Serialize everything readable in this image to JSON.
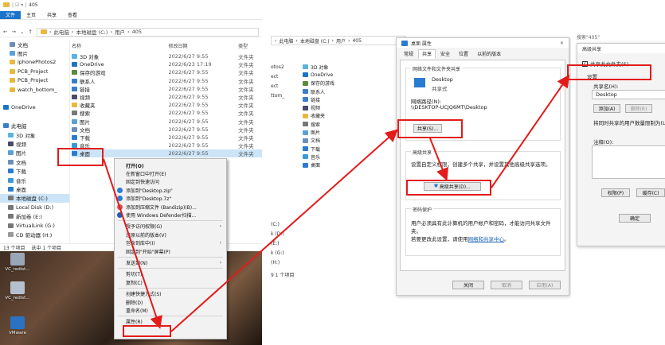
{
  "explorer": {
    "title": "405",
    "ribbon_tabs": [
      "文件",
      "主页",
      "共享",
      "查看"
    ],
    "breadcrumb": [
      "此电脑",
      "本地磁盘 (C:)",
      "用户",
      "405"
    ],
    "sidebar": [
      {
        "label": "文档",
        "icon": "document-icon"
      },
      {
        "label": "图片",
        "icon": "picture-icon"
      },
      {
        "label": "iphonePhotos2",
        "icon": "folder-icon"
      },
      {
        "label": "PCB_Project",
        "icon": "folder-icon"
      },
      {
        "label": "PCB_Project",
        "icon": "folder-icon"
      },
      {
        "label": "watch_bottom_",
        "icon": "folder-icon"
      },
      {
        "label": "",
        "icon": ""
      },
      {
        "label": "OneDrive",
        "icon": "cloud-icon"
      },
      {
        "label": "",
        "icon": ""
      },
      {
        "label": "此电脑",
        "icon": "computer-icon"
      },
      {
        "label": "3D 对象",
        "icon": "cube-icon"
      },
      {
        "label": "视频",
        "icon": "video-icon"
      },
      {
        "label": "图片",
        "icon": "picture-icon"
      },
      {
        "label": "文档",
        "icon": "document-icon"
      },
      {
        "label": "下载",
        "icon": "download-icon"
      },
      {
        "label": "音乐",
        "icon": "music-icon"
      },
      {
        "label": "桌面",
        "icon": "desktop-icon"
      },
      {
        "label": "本地磁盘 (C:)",
        "icon": "drive-icon"
      },
      {
        "label": "Local Disk (D:)",
        "icon": "drive-icon"
      },
      {
        "label": "新加卷 (E:)",
        "icon": "drive-icon"
      },
      {
        "label": "VirtualLink (G:)",
        "icon": "drive-icon"
      },
      {
        "label": "CD 驱动器 (H:)",
        "icon": "cd-icon"
      }
    ],
    "columns": [
      "名称",
      "修改日期",
      "类型"
    ],
    "files": [
      {
        "name": "3D 对象",
        "date": "2022/6/27 9:55",
        "type": "文件夹"
      },
      {
        "name": "OneDrive",
        "date": "2022/6/23 17:19",
        "type": "文件夹"
      },
      {
        "name": "保存的游戏",
        "date": "2022/6/27 9:55",
        "type": "文件夹"
      },
      {
        "name": "联系人",
        "date": "2022/6/27 9:55",
        "type": "文件夹"
      },
      {
        "name": "链接",
        "date": "2022/6/27 9:55",
        "type": "文件夹"
      },
      {
        "name": "视频",
        "date": "2022/6/27 9:55",
        "type": "文件夹"
      },
      {
        "name": "收藏夹",
        "date": "2022/6/27 9:55",
        "type": "文件夹"
      },
      {
        "name": "搜索",
        "date": "2022/6/27 9:55",
        "type": "文件夹"
      },
      {
        "name": "图片",
        "date": "2022/6/27 9:55",
        "type": "文件夹"
      },
      {
        "name": "文档",
        "date": "2022/6/27 9:55",
        "type": "文件夹"
      },
      {
        "name": "下载",
        "date": "2022/6/27 9:55",
        "type": "文件夹"
      },
      {
        "name": "音乐",
        "date": "2022/6/27 9:55",
        "type": "文件夹"
      },
      {
        "name": "桌面",
        "date": "2022/6/27 9:55",
        "type": "文件夹"
      }
    ],
    "status": [
      "13 个项目",
      "选中 1 个项目"
    ],
    "desktop_icons": [
      "VC_redist...",
      "VC_redist...",
      "VMware"
    ]
  },
  "context_menu": [
    {
      "label": "打开(O)",
      "bold": true
    },
    {
      "label": "在新窗口中打开(E)"
    },
    {
      "label": "固定到快速访问"
    },
    {
      "label": "添加到\"Desktop.zip\"",
      "icon": true
    },
    {
      "label": "添加到\"Desktop.7z\"",
      "icon": true
    },
    {
      "label": "添加到压缩文件 (Bandizip)(B)...",
      "icon": true
    },
    {
      "label": "使用 Windows Defender扫描...",
      "icon": true
    },
    {
      "sep": true
    },
    {
      "label": "授予访问权限(G)",
      "arrow": true
    },
    {
      "label": "还原以前的版本(V)"
    },
    {
      "label": "包含到库中(I)",
      "arrow": true
    },
    {
      "label": "固定到\"开始\"屏幕(P)"
    },
    {
      "sep": true
    },
    {
      "label": "发送到(N)",
      "arrow": true
    },
    {
      "sep": true
    },
    {
      "label": "剪切(T)"
    },
    {
      "label": "复制(C)"
    },
    {
      "sep": true
    },
    {
      "label": "创建快捷方式(S)"
    },
    {
      "label": "删除(D)"
    },
    {
      "label": "重命名(M)"
    },
    {
      "sep": true
    },
    {
      "label": "属性(R)"
    }
  ],
  "middle": {
    "breadcrumb": [
      "此电脑",
      "本地磁盘 (C:)",
      "用户",
      "405"
    ],
    "sidebar_frag": [
      "otos2",
      "ect",
      "ect",
      "ttom_"
    ],
    "files": [
      "3D 对象",
      "OneDrive",
      "保存的游戏",
      "联系人",
      "链接",
      "视频",
      "收藏夹",
      "搜索",
      "图片",
      "文档",
      "下载",
      "音乐",
      "桌面"
    ],
    "drive_frag": [
      "(C:)",
      "k (D:)",
      "(E:)",
      "k (G:)",
      "(H:)"
    ],
    "status_frag": "9 1 个项目",
    "dialog": {
      "title": "桌面 属性",
      "tabs": [
        "常规",
        "共享",
        "安全",
        "位置",
        "以前的版本"
      ],
      "g1_title": "网络文件和文件夹共享",
      "item_name": "Desktop",
      "item_state": "共享式",
      "net_path_label": "网络路径(N):",
      "net_path": "\\\\DESKTOP-UCJQ6MT\\Desktop",
      "share_btn": "共享(S)...",
      "g2_title": "高级共享",
      "g2_desc": "设置自定义权限，创建多个共享，并设置其他高级共享选项。",
      "adv_btn": "高级共享(D)...",
      "g3_title": "密码保护",
      "g3_desc1": "用户必须具有此计算机的用户帐户和密码，才能访问共享文件夹。",
      "g3_desc2_prefix": "若要更改此设置，请使用",
      "g3_link": "网络和共享中心",
      "g3_desc2_suffix": "。",
      "btn_close": "关闭",
      "btn_cancel": "取消",
      "btn_apply": "应用(A)"
    }
  },
  "right": {
    "header_frag": "搜索\"405\"",
    "dialog": {
      "title": "高级共享",
      "share_checkbox": "共享此文件夹(S)",
      "settings_label": "设置",
      "share_name_label": "共享名(H):",
      "share_name": "Desktop",
      "add_btn": "添加(A)",
      "remove_btn": "删除(R)",
      "limit_label": "将同时共享的用户数量限制为(L):",
      "note_label": "注释(O):",
      "perm_btn": "权限(P)",
      "cache_btn": "缓存(C)",
      "ok_btn": "确定"
    }
  },
  "colors": {
    "highlight": "#e31b1b",
    "ribbon_blue": "#1a73c9",
    "select": "#cce4f7"
  }
}
